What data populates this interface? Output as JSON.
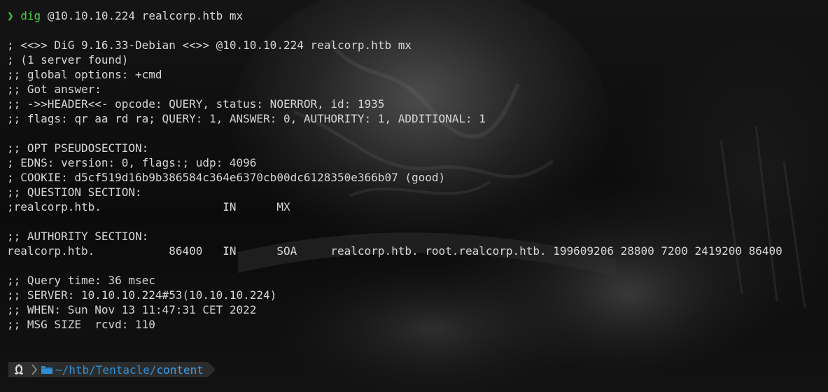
{
  "prompt": {
    "arrow": "❯",
    "command_name": "dig",
    "command_args": " @10.10.10.224 realcorp.htb mx"
  },
  "output_lines": [
    "; <<>> DiG 9.16.33-Debian <<>> @10.10.10.224 realcorp.htb mx",
    "; (1 server found)",
    ";; global options: +cmd",
    ";; Got answer:",
    ";; ->>HEADER<<- opcode: QUERY, status: NOERROR, id: 1935",
    ";; flags: qr aa rd ra; QUERY: 1, ANSWER: 0, AUTHORITY: 1, ADDITIONAL: 1",
    "",
    ";; OPT PSEUDOSECTION:",
    "; EDNS: version: 0, flags:; udp: 4096",
    "; COOKIE: d5cf519d16b9b386584c364e6370cb00dc6128350e366b07 (good)",
    ";; QUESTION SECTION:",
    ";realcorp.htb.                  IN      MX",
    "",
    ";; AUTHORITY SECTION:",
    "realcorp.htb.           86400   IN      SOA     realcorp.htb. root.realcorp.htb. 199609206 28800 7200 2419200 86400",
    "",
    ";; Query time: 36 msec",
    ";; SERVER: 10.10.10.224#53(10.10.10.224)",
    ";; WHEN: Sun Nov 13 11:47:31 CET 2022",
    ";; MSG SIZE  rcvd: 110"
  ],
  "status_prompt": {
    "os_icon": "linux-penguin-icon",
    "folder_icon": "folder-icon",
    "dir_prefix": "~/htb/Tentacle/",
    "dir_current": "content"
  },
  "colors": {
    "prompt_green": "#43d143",
    "dir_blue": "#2f8fd6",
    "text": "#d6d6d6",
    "segment_bg": "#2b2b2b"
  }
}
